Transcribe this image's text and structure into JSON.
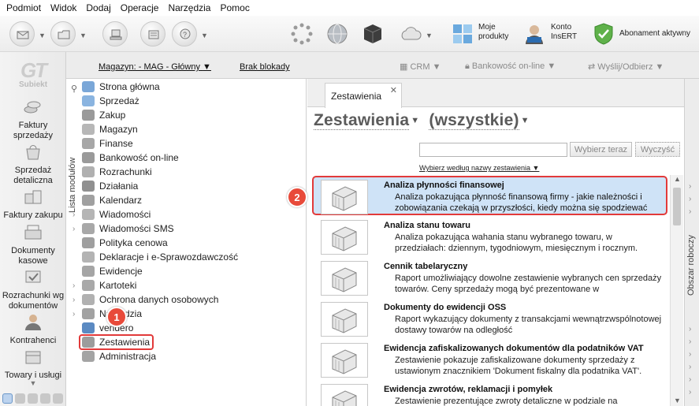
{
  "menu": [
    "Podmiot",
    "Widok",
    "Dodaj",
    "Operacje",
    "Narzędzia",
    "Pomoc"
  ],
  "toolbar": {
    "right": [
      {
        "label": "Moje\nprodukty",
        "icon": "products-icon"
      },
      {
        "label": "Konto\nInsERT",
        "icon": "account-icon"
      },
      {
        "label": "Abonament aktywny",
        "icon": "shield-check-icon"
      }
    ]
  },
  "logo": {
    "text": "Subiekt"
  },
  "left_modules": [
    {
      "label": "Faktury sprzedaży",
      "icon": "coins-icon"
    },
    {
      "label": "Sprzedaż detaliczna",
      "icon": "bag-icon"
    },
    {
      "label": "Faktury zakupu",
      "icon": "boxes-icon"
    },
    {
      "label": "Dokumenty kasowe",
      "icon": "cash-register-icon"
    },
    {
      "label": "Rozrachunki wg dokumentów",
      "icon": "settlement-icon"
    },
    {
      "label": "Kontrahenci",
      "icon": "person-icon"
    },
    {
      "label": "Towary i usługi",
      "icon": "goods-icon"
    }
  ],
  "subbar": {
    "warehouse": "Magazyn: - MAG - Główny",
    "lock": "Brak blokady",
    "crm": "CRM",
    "banking": "Bankowość on-line",
    "send": "Wyślij/Odbierz"
  },
  "modules_panel": {
    "vertical_label": "Lista modułów",
    "items": [
      "Strona główna",
      "Sprzedaż",
      "Zakup",
      "Magazyn",
      "Finanse",
      "Bankowość on-line",
      "Rozrachunki",
      "Działania",
      "Kalendarz",
      "Wiadomości",
      "Wiadomości SMS",
      "Polityka cenowa",
      "Deklaracje i e-Sprawozdawczość",
      "Ewidencje",
      "Kartoteki",
      "Ochrona danych osobowych",
      "Narzędzia",
      "vendero",
      "Zestawienia",
      "Administracja"
    ]
  },
  "badges": {
    "one": "1",
    "two": "2"
  },
  "main": {
    "tab": "Zestawienia",
    "heading_left": "Zestawienia",
    "heading_right": "(wszystkie)",
    "search_value": "",
    "btn_choose": "Wybierz teraz",
    "btn_clear": "Wyczyść",
    "sort_link": "Wybierz według nazwy zestawienia",
    "reports": [
      {
        "title": "Analiza płynności finansowej",
        "desc": "Analiza pokazująca płynność finansową firmy - jakie należności i zobowiązania czekają w przyszłości, kiedy można się spodziewać"
      },
      {
        "title": "Analiza stanu towaru",
        "desc": "Analiza pokazująca wahania stanu wybranego towaru, w przedziałach: dziennym, tygodniowym, miesięcznym i rocznym."
      },
      {
        "title": "Cennik tabelaryczny",
        "desc": "Raport umożliwiający dowolne zestawienie wybranych cen sprzedaży towarów. Ceny sprzedaży mogą być prezentowane w"
      },
      {
        "title": "Dokumenty do ewidencji OSS",
        "desc": "Raport wykazujący dokumenty z transakcjami wewnątrzwspólnotowej dostawy towarów na odległość"
      },
      {
        "title": "Ewidencja zafiskalizowanych dokumentów dla podatników VAT",
        "desc": "Zestawienie pokazuje zafiskalizowane dokumenty sprzedaży z ustawionym znacznikiem 'Dokument fiskalny dla podatnika VAT'."
      },
      {
        "title": "Ewidencja zwrotów, reklamacji i pomyłek",
        "desc": "Zestawienie prezentujące zwroty detaliczne w podziale na"
      }
    ]
  },
  "right_panel": {
    "label": "Obszar roboczy"
  }
}
